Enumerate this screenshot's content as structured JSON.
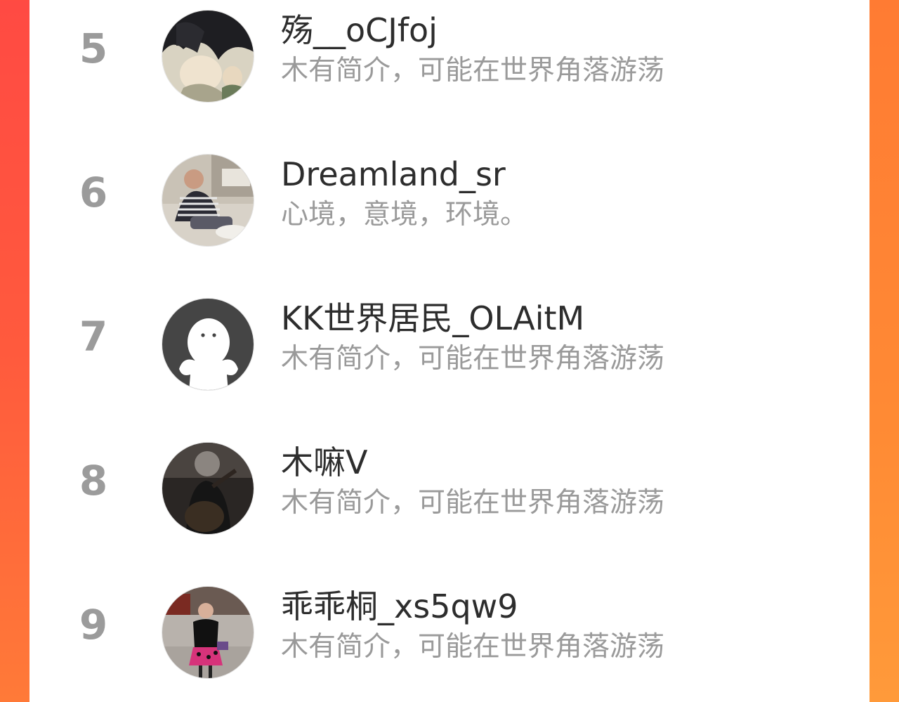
{
  "leaderboard": {
    "entries": [
      {
        "rank": "5",
        "name": "殇__oCJfoj",
        "bio": "木有简介，可能在世界角落游荡",
        "avatar_icon": "anime-avatar"
      },
      {
        "rank": "6",
        "name": "Dreamland_sr",
        "bio": "心境，意境，环境。",
        "avatar_icon": "photo-avatar"
      },
      {
        "rank": "7",
        "name": "KK世界居民_OLAitM",
        "bio": "木有简介，可能在世界角落游荡",
        "avatar_icon": "default-ghost-avatar"
      },
      {
        "rank": "8",
        "name": "木嘛V",
        "bio": "木有简介，可能在世界角落游荡",
        "avatar_icon": "photo-avatar"
      },
      {
        "rank": "9",
        "name": "乖乖桐_xs5qw9",
        "bio": "木有简介，可能在世界角落游荡",
        "avatar_icon": "photo-avatar"
      }
    ]
  },
  "colors": {
    "background_left": "#ff4a43",
    "background_right": "#ff8a34",
    "rank_text": "#9b9b9b",
    "name_text": "#2d2d2d",
    "bio_text": "#9a9a9a"
  }
}
